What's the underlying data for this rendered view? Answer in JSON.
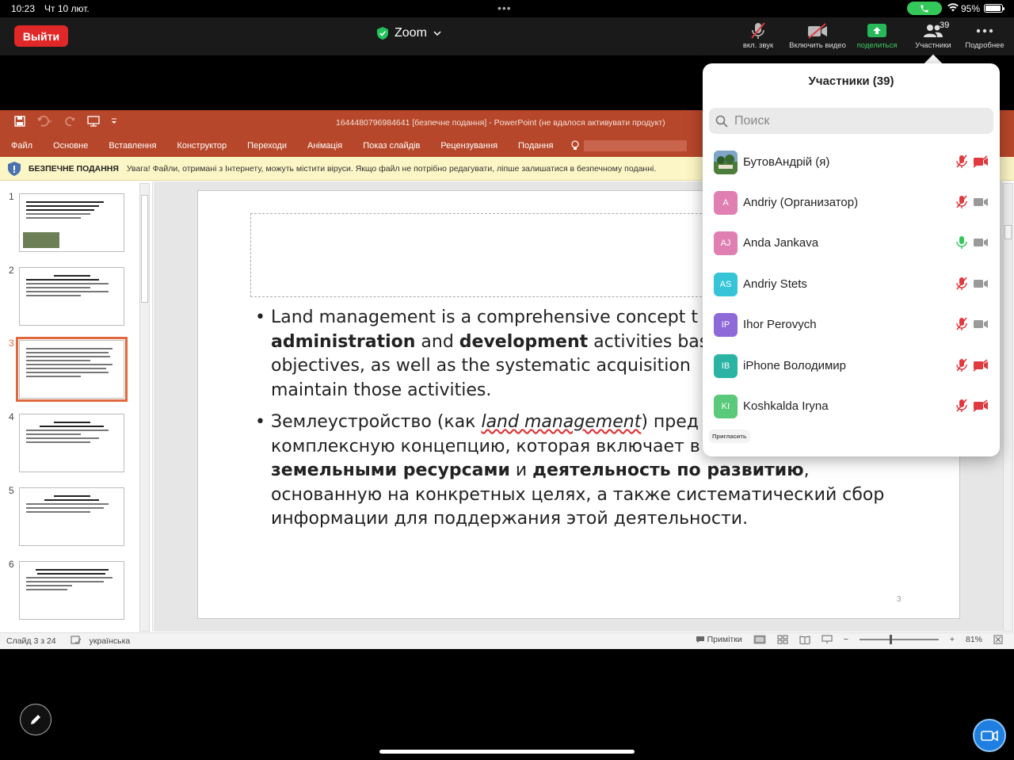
{
  "status_bar": {
    "time": "10:23",
    "date": "Чт 10 лют.",
    "battery": "95%"
  },
  "zoom": {
    "leave": "Выйти",
    "title": "Zoom",
    "controls": [
      {
        "label": "вкл. звук",
        "icon": "mic-muted-icon"
      },
      {
        "label": "Включить видео",
        "icon": "video-off-icon"
      },
      {
        "label": "поделиться",
        "icon": "share-screen-icon"
      },
      {
        "label": "Участники",
        "icon": "participants-icon",
        "badge": "39"
      },
      {
        "label": "Подробнее",
        "icon": "more-icon"
      }
    ]
  },
  "powerpoint": {
    "doc_title": "1644480796984641 [безпечне подання] - PowerPoint (не вдалося активувати продукт)",
    "tabs": [
      "Файл",
      "Основне",
      "Вставлення",
      "Конструктор",
      "Переходи",
      "Анімація",
      "Показ слайдів",
      "Рецензування",
      "Подання"
    ],
    "protected_title": "БЕЗПЕЧНЕ ПОДАННЯ",
    "protected_message": "Увага! Файли, отримані з Інтернету, можуть містити віруси. Якщо файл не потрібно редагувати, ліпше залишатися в безпечному поданні.",
    "thumbnails": [
      "1",
      "2",
      "3",
      "4",
      "5",
      "6"
    ],
    "slide": {
      "b1_pre": "Land management is a comprehensive concept t",
      "b1_bold1": "administration",
      "b1_mid1": " and ",
      "b1_bold2": "development",
      "b1_post": " activities base",
      "b1_line3": "objectives, as well as the systematic acquisition",
      "b1_line4": "maintain those activities.",
      "b2_pre": "Землеустройство (как ",
      "b2_italic": "land management",
      "b2_post": ") пред",
      "b2_line2": "комплексную концепцию, которая включает в",
      "b2_bold1": "земельными ресурсами",
      "b2_mid": " и ",
      "b2_bold2": "деятельность по развитию",
      "b2_comma": ",",
      "b2_line4": "основанную на конкретных целях, а также систематический сбор",
      "b2_line5": "информации для поддержания этой деятельности.",
      "page_number": "3"
    },
    "status": {
      "slide_of": "Слайд 3 з 24",
      "language": "українська",
      "notes": "Примітки",
      "zoom": "81%"
    }
  },
  "participants": {
    "title": "Участники (39)",
    "search_placeholder": "Поиск",
    "invite": "Пригласить",
    "list": [
      {
        "initials": "",
        "name": "БутовАндрій (я)",
        "mic": "muted",
        "video": "off",
        "avatar_color": "#4a7a3a"
      },
      {
        "initials": "A",
        "name": "Andriy (Организатор)",
        "mic": "muted",
        "video": "on",
        "avatar_color": "#e07fb1"
      },
      {
        "initials": "AJ",
        "name": "Anda Jankava",
        "mic": "active",
        "video": "on",
        "avatar_color": "#e07fb1"
      },
      {
        "initials": "AS",
        "name": "Andriy Stets",
        "mic": "muted",
        "video": "on",
        "avatar_color": "#36c5d8"
      },
      {
        "initials": "IP",
        "name": "Ihor Perovych",
        "mic": "muted",
        "video": "on",
        "avatar_color": "#8e6ad8"
      },
      {
        "initials": "IB",
        "name": "iPhone Володимир",
        "mic": "muted",
        "video": "off",
        "avatar_color": "#2bb3a3"
      },
      {
        "initials": "KI",
        "name": "Koshkalda Iryna",
        "mic": "muted",
        "video": "off",
        "avatar_color": "#5bc97a"
      }
    ]
  },
  "colors": {
    "zoom_red": "#e02828",
    "ppt_orange": "#b7472a",
    "zoom_blue": "#1f7fe0",
    "mute_red": "#e0393e"
  }
}
